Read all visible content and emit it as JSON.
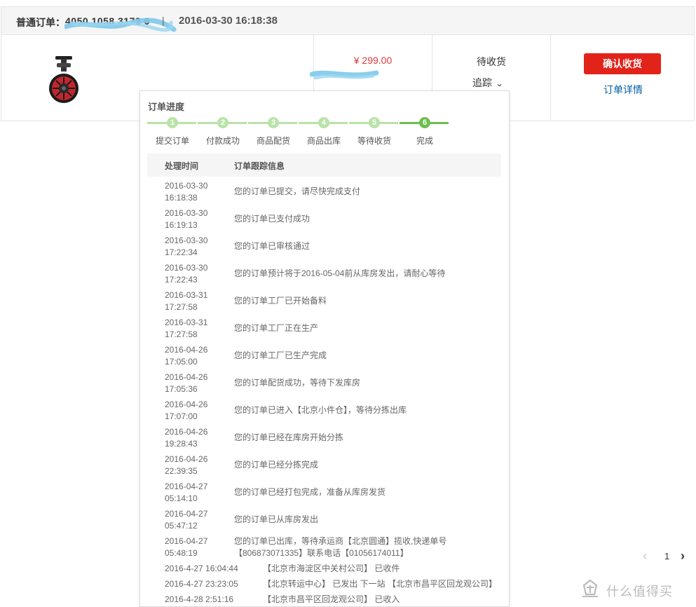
{
  "order": {
    "type_label": "普通订单：",
    "number": "4050 1058 3172 6",
    "separator": "|",
    "date": "2016-03-30 16:18:38",
    "price": "¥ 299.00",
    "status": "待收货",
    "track_label": "追踪",
    "confirm_label": "确认收货",
    "detail_label": "订单详情",
    "product_icon": "self-balancing-unicycle-image"
  },
  "tracking_popup": {
    "title": "订单进度",
    "steps": [
      {
        "num": "1",
        "label": "提交订单"
      },
      {
        "num": "2",
        "label": "付款成功"
      },
      {
        "num": "3",
        "label": "商品配货"
      },
      {
        "num": "4",
        "label": "商品出库"
      },
      {
        "num": "5",
        "label": "等待收货"
      },
      {
        "num": "6",
        "label": "完成"
      }
    ],
    "header_time": "处理时间",
    "header_info": "订单跟踪信息",
    "logs": [
      {
        "date": "2016-03-30",
        "time": "16:18:38",
        "info": "您的订单已提交，请尽快完成支付"
      },
      {
        "date": "2016-03-30",
        "time": "16:19:13",
        "info": "您的订单已支付成功"
      },
      {
        "date": "2016-03-30",
        "time": "17:22:34",
        "info": "您的订单已审核通过"
      },
      {
        "date": "2016-03-30",
        "time": "17:22:43",
        "info": "您的订单预计将于2016-05-04前从库房发出，请耐心等待"
      },
      {
        "date": "2016-03-31",
        "time": "17:27:58",
        "info": "您的订单工厂已开始备料"
      },
      {
        "date": "2016-03-31",
        "time": "17:27:58",
        "info": "您的订单工厂正在生产"
      },
      {
        "date": "2016-04-26",
        "time": "17:05:00",
        "info": "您的订单工厂已生产完成"
      },
      {
        "date": "2016-04-26",
        "time": "17:05:36",
        "info": "您的订单配货成功，等待下发库房"
      },
      {
        "date": "2016-04-26",
        "time": "17:07:00",
        "info": "您的订单已进入【北京小件仓】，等待分拣出库"
      },
      {
        "date": "2016-04-26",
        "time": "19:28:43",
        "info": "您的订单已经在库房开始分拣"
      },
      {
        "date": "2016-04-26",
        "time": "22:39:35",
        "info": "您的订单已经分拣完成"
      },
      {
        "date": "2016-04-27",
        "time": "05:14:10",
        "info": "您的订单已经打包完成，准备从库房发货"
      },
      {
        "date": "2016-04-27",
        "time": "05:47:12",
        "info": "您的订单已从库房发出"
      },
      {
        "date": "2016-04-27",
        "time": "05:48:19",
        "info": "您的订单已出库，等待承运商【北京圆通】揽收,快递单号【806873071335】联系电话【01056174011】"
      }
    ],
    "courier_logs": [
      {
        "datetime": "2016-4-27 16:04:44",
        "info": "【北京市海淀区中关村公司】 已收件"
      },
      {
        "datetime": "2016-4-27 23:23:05",
        "info": "【北京转运中心】 已发出 下一站 【北京市昌平区回龙观公司】"
      },
      {
        "datetime": "2016-4-28 2:51:16",
        "info": "【北京市昌平区回龙观公司】 已收入"
      }
    ]
  },
  "pager": {
    "prev": "‹",
    "current": "1",
    "next": "›"
  },
  "watermark": {
    "logo_icon": "smzdm-logo-icon",
    "text": "什么值得买"
  },
  "colors": {
    "accent_red": "#e2231a",
    "price_red": "#e4393c",
    "link_blue": "#005ea7",
    "step_light_green": "#b9e3a9",
    "step_dark_green": "#6cbf4c"
  }
}
